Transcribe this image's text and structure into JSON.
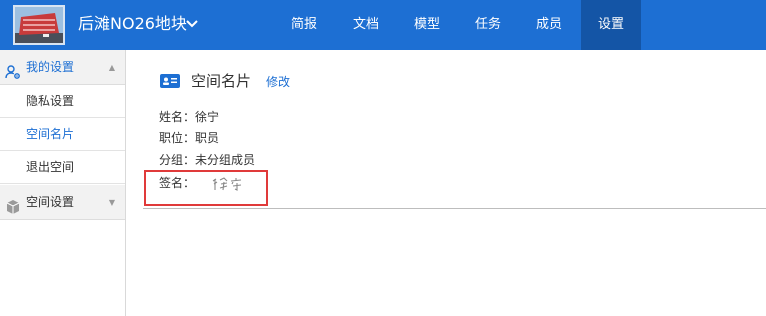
{
  "header": {
    "project_title": "后滩NO26地块",
    "logo_icon": "building-photo-icon",
    "chevron_icon": "chevron-down-icon",
    "nav": [
      {
        "label": "简报"
      },
      {
        "label": "文档"
      },
      {
        "label": "模型"
      },
      {
        "label": "任务"
      },
      {
        "label": "成员"
      },
      {
        "label": "设置",
        "active": true
      }
    ],
    "colors": {
      "bar": "#1d6fd3",
      "active": "#1455a6"
    }
  },
  "sidebar": {
    "groups": [
      {
        "label": "我的设置",
        "icon": "user-settings-icon",
        "expanded": true,
        "items": [
          {
            "label": "隐私设置"
          },
          {
            "label": "空间名片",
            "active": true
          },
          {
            "label": "退出空间"
          }
        ]
      },
      {
        "label": "空间设置",
        "icon": "cube-icon",
        "expanded": false,
        "items": []
      }
    ]
  },
  "card": {
    "icon": "id-card-icon",
    "title": "空间名片",
    "edit_label": "修改",
    "fields": [
      {
        "label": "姓名：",
        "value": "徐宁"
      },
      {
        "label": "职位：",
        "value": "职员"
      },
      {
        "label": "分组：",
        "value": "未分组成员"
      },
      {
        "label": "签名：",
        "value": "徐宁"
      }
    ],
    "signature_style": "handwritten",
    "highlight_color": "#e03a3a"
  }
}
